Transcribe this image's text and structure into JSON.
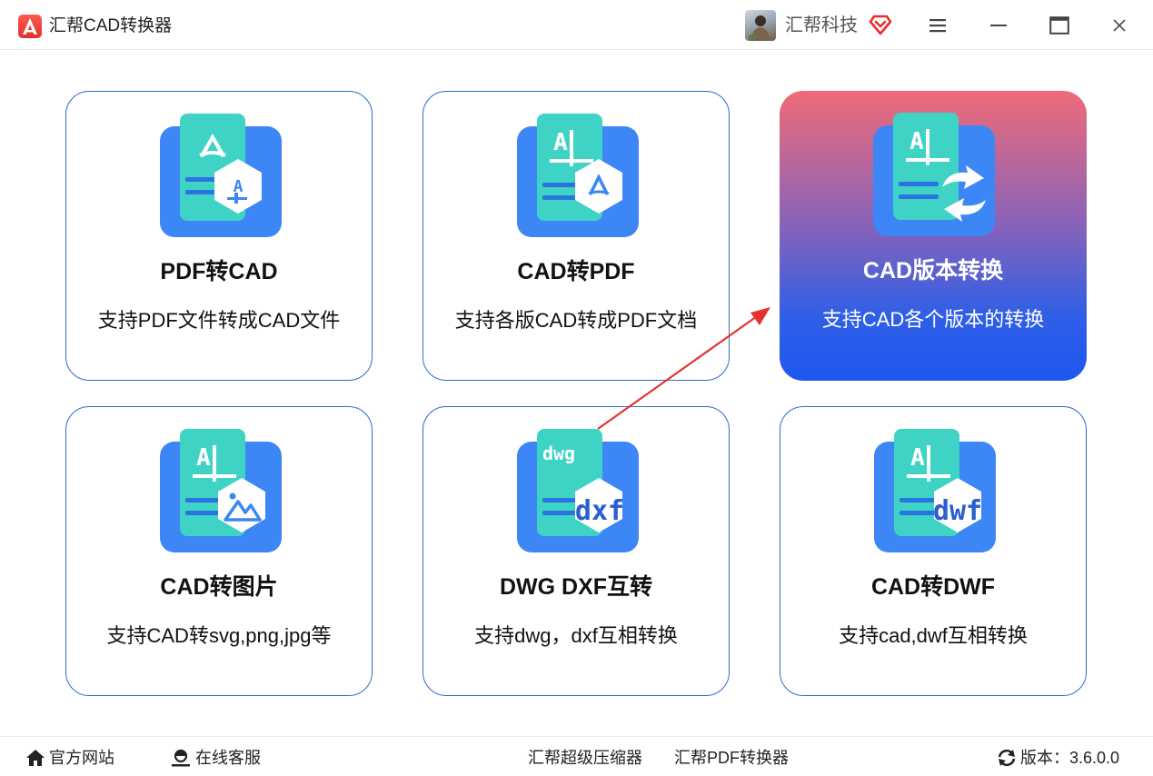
{
  "window": {
    "app_title": "汇帮CAD转换器",
    "company": "汇帮科技"
  },
  "icons": {
    "app_logo": "cad-logo-icon",
    "vip": "vip-diamond-icon",
    "menu": "menu-icon",
    "minimize": "minimize-icon",
    "maximize": "maximize-icon",
    "close": "close-icon",
    "home": "home-icon",
    "support": "support-icon",
    "refresh": "refresh-icon"
  },
  "colors": {
    "card_border": "#2c6bc9",
    "active_gradient_top": "#f06a78",
    "active_gradient_bottom": "#1e56f0",
    "icon_blue": "#3d86f5",
    "icon_teal": "#3fd3c6",
    "arrow_red": "#e5322d"
  },
  "cards": [
    {
      "title": "PDF转CAD",
      "desc": "支持PDF文件转成CAD文件",
      "icon": "pdf-to-cad-icon",
      "active": false
    },
    {
      "title": "CAD转PDF",
      "desc": "支持各版CAD转成PDF文档",
      "icon": "cad-to-pdf-icon",
      "active": false
    },
    {
      "title": "CAD版本转换",
      "desc": "支持CAD各个版本的转换",
      "icon": "cad-version-convert-icon",
      "active": true
    },
    {
      "title": "CAD转图片",
      "desc": "支持CAD转svg,png,jpg等",
      "icon": "cad-to-image-icon",
      "active": false
    },
    {
      "title": "DWG DXF互转",
      "desc": "支持dwg，dxf互相转换",
      "icon": "dwg-dxf-convert-icon",
      "icon_text_top": "dwg",
      "icon_text_bottom": "dxf",
      "active": false
    },
    {
      "title": "CAD转DWF",
      "desc": "支持cad,dwf互相转换",
      "icon": "cad-to-dwf-icon",
      "icon_text_bottom": "dwf",
      "active": false
    }
  ],
  "footer": {
    "website": "官方网站",
    "support": "在线客服",
    "link1": "汇帮超级压缩器",
    "link2": "汇帮PDF转换器",
    "version": "版本：3.6.0.0"
  }
}
